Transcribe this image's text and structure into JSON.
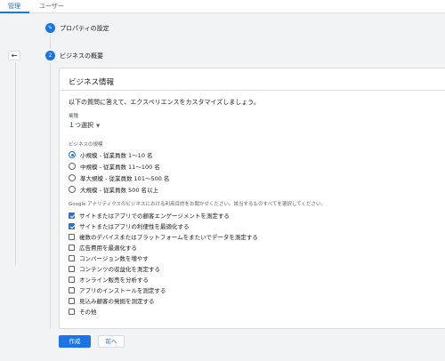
{
  "tabs": [
    {
      "label": "管理",
      "active": true
    },
    {
      "label": "ユーザー",
      "active": false
    }
  ],
  "back_icon": "←",
  "steps": [
    {
      "number": "✎",
      "label": "プロパティの設定",
      "icon": "pencil-icon"
    },
    {
      "number": "2",
      "label": "ビジネスの概要"
    }
  ],
  "card": {
    "title": "ビジネス情報",
    "intro": "以下の質問に答えて、エクスペリエンスをカスタマイズしましょう。",
    "industry_label": "業種",
    "industry_value": "１つ選択",
    "size_label": "ビジネスの規模",
    "sizes": [
      {
        "label": "小規模 - 従業員数 1～10 名",
        "selected": true
      },
      {
        "label": "中規模 - 従業員数 11～100 名",
        "selected": false
      },
      {
        "label": "準大規模 - 従業員数 101～500 名",
        "selected": false
      },
      {
        "label": "大規模 - 従業員数 500 名以上",
        "selected": false
      }
    ],
    "purpose_label": "Google アナリティクスのビジネスにおける利用目的をお聞かせください。該当するものすべてを選択してください。",
    "purposes": [
      {
        "label": "サイトまたはアプリでの顧客エンゲージメントを測定する",
        "checked": true
      },
      {
        "label": "サイトまたはアプリの利便性を最適化する",
        "checked": true
      },
      {
        "label": "複数のデバイスまたはプラットフォームをまたいでデータを測定する",
        "checked": false
      },
      {
        "label": "広告費用を最適化する",
        "checked": false
      },
      {
        "label": "コンバージョン数を増やす",
        "checked": false
      },
      {
        "label": "コンテンツの収益化を測定する",
        "checked": false
      },
      {
        "label": "オンライン販売を分析する",
        "checked": false
      },
      {
        "label": "アプリのインストールを測定する",
        "checked": false
      },
      {
        "label": "見込み顧客の発掘を測定する",
        "checked": false
      },
      {
        "label": "その他",
        "checked": false
      }
    ]
  },
  "buttons": {
    "create": "作成",
    "back": "前へ"
  },
  "colors": {
    "accent": "#1a73e8",
    "background": "#f1f3f4"
  }
}
